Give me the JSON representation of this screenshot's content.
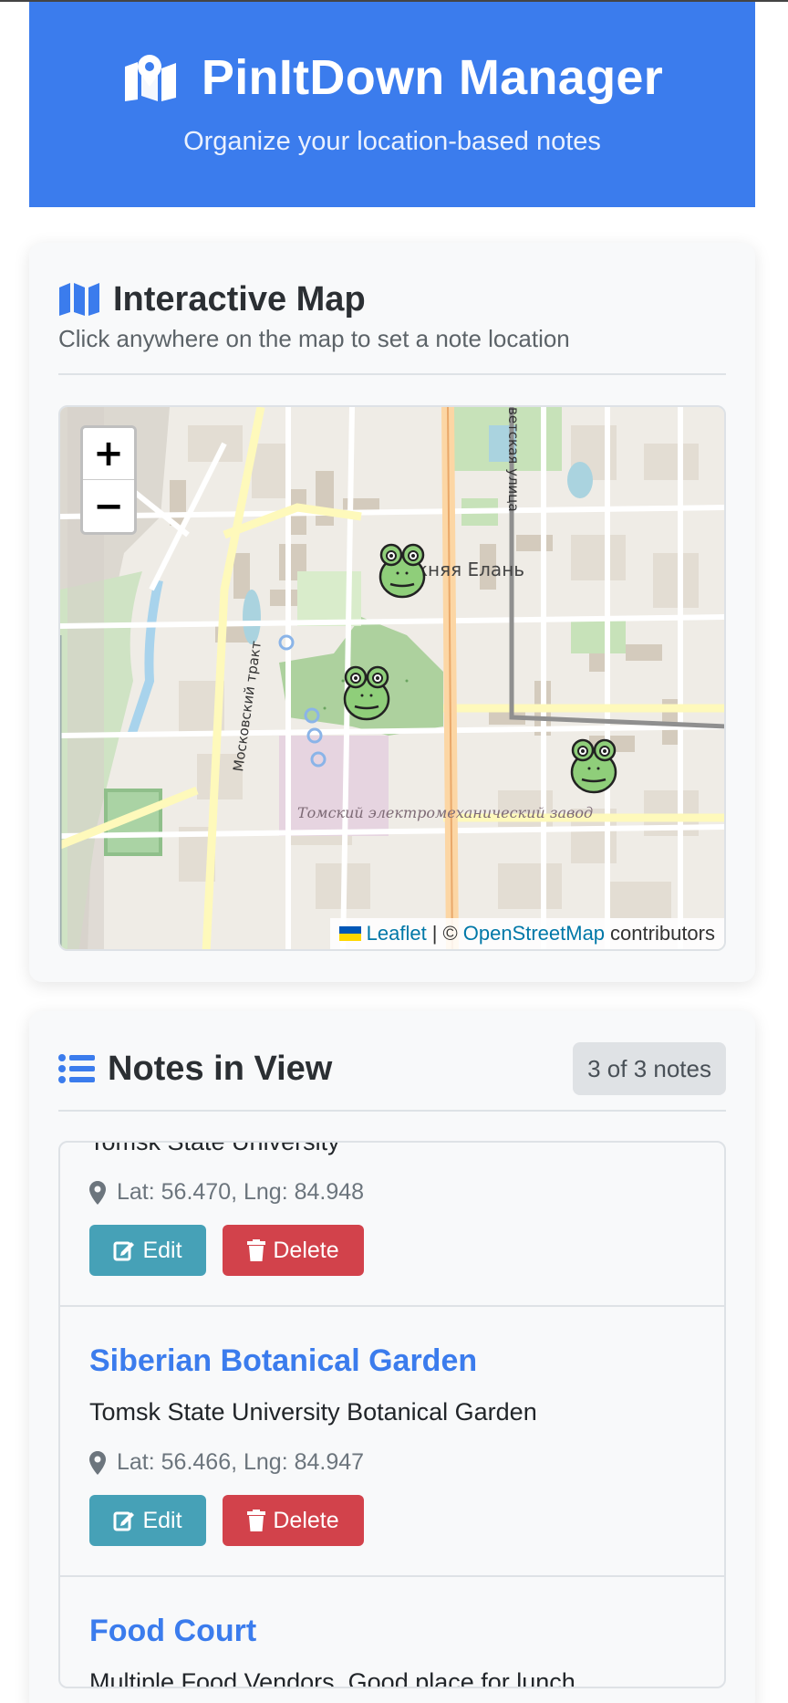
{
  "header": {
    "title": "PinItDown Manager",
    "subtitle": "Organize your location-based notes",
    "icon": "map-marked-icon"
  },
  "colors": {
    "primary": "#3b7ced",
    "edit": "#46a1b7",
    "delete": "#d2424b",
    "badge_bg": "#dfe2e5"
  },
  "map_section": {
    "title": "Interactive Map",
    "subtitle": "Click anywhere on the map to set a note location",
    "icon": "map-icon",
    "zoom_in": "+",
    "zoom_out": "−",
    "labels": {
      "district": "ижняя Елань",
      "street_1": "Московский тракт",
      "street_2": "ветская улица",
      "factory": "Томский электромеханический завод"
    },
    "attribution": {
      "leaflet": "Leaflet",
      "separator": "| ©",
      "osm": "OpenStreetMap",
      "suffix": "contributors"
    },
    "marker_icon": "frog-marker-icon"
  },
  "notes_section": {
    "title": "Notes in View",
    "icon": "list-icon",
    "count_badge": "3 of 3 notes",
    "edit_label": "Edit",
    "delete_label": "Delete",
    "notes": [
      {
        "title": "",
        "description": "Tomsk State University",
        "coords": "Lat: 56.470, Lng: 84.948"
      },
      {
        "title": "Siberian Botanical Garden",
        "description": "Tomsk State University Botanical Garden",
        "coords": "Lat: 56.466, Lng: 84.947"
      },
      {
        "title": "Food Court",
        "description": "Multiple Food Vendors. Good place for lunch",
        "coords": ""
      }
    ]
  }
}
